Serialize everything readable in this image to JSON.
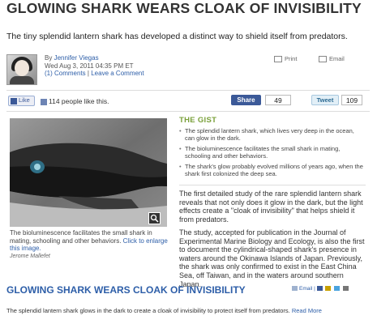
{
  "article": {
    "headline": "GLOWING SHARK WEARS CLOAK OF INVISIBILITY",
    "deck": "The tiny splendid lantern shark has developed a distinct way to shield itself from predators.",
    "byline": {
      "by": "By",
      "author": "Jennifer Viegas",
      "date": "Wed Aug 3, 2011 04:35 PM ET",
      "comments_label": "(1) Comments",
      "separator": "|",
      "leave_comment_label": "Leave a Comment"
    },
    "tools": {
      "print_label": "Print",
      "email_label": "Email"
    }
  },
  "social": {
    "like_label": "Like",
    "like_count_text": "114 people like this.",
    "share_label": "Share",
    "share_count": "49",
    "tweet_label": "Tweet",
    "tweet_count": "109"
  },
  "image": {
    "caption": "The bioluminescence facilitates the small shark in mating, schooling and other behaviors.",
    "enlarge_link": "Click to enlarge this image.",
    "credit": "Jerome Mallefet",
    "zoom_icon": "magnifier-icon"
  },
  "gist": {
    "title": "THE GIST",
    "items": [
      "The splendid lantern shark, which lives very deep in the ocean, can glow in the dark.",
      "The bioluminescence facilitates the small shark in mating, schooling and other behaviors.",
      "The shark's glow probably evolved millions of years ago, when the shark first colonized the deep sea."
    ]
  },
  "body": {
    "paragraphs": [
      "The first detailed study of the rare splendid lantern shark reveals that not only does it glow in the dark, but the light effects create a \"cloak of invisibility\" that helps shield it from predators.",
      "The study, accepted for publication in the Journal of Experimental Marine Biology and Ecology, is also the first to document the cylindrical-shaped shark's presence in waters around the Okinawa Islands of Japan. Previously, the shark was only confirmed to exist in the East China Sea, off Taiwan, and in the waters around southern Japan."
    ]
  },
  "related": {
    "title": "GLOWING SHARK WEARS CLOAK OF INVISIBILITY",
    "description": "The splendid lantern shark glows in the dark to create a cloak of invisibility to protect itself from predators.",
    "read_more": "Read More",
    "email_label": "Email",
    "separator": "|"
  },
  "colors": {
    "link_blue": "#2d5ea8",
    "gist_green": "#7aa03a",
    "facebook_blue": "#3b5998"
  }
}
